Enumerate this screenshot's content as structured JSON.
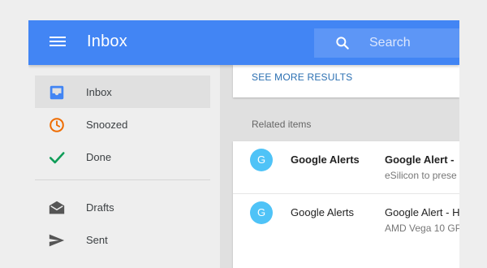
{
  "header": {
    "title": "Inbox",
    "search_placeholder": "Search",
    "accent_color": "#4285f4"
  },
  "sidebar": {
    "items": [
      {
        "label": "Inbox",
        "icon": "inbox-icon",
        "active": true,
        "color": "#4285f4"
      },
      {
        "label": "Snoozed",
        "icon": "clock-icon",
        "active": false,
        "color": "#ef6c00"
      },
      {
        "label": "Done",
        "icon": "check-icon",
        "active": false,
        "color": "#0f9d58"
      },
      {
        "label": "Drafts",
        "icon": "drafts-icon",
        "active": false,
        "color": "#555555"
      },
      {
        "label": "Sent",
        "icon": "send-icon",
        "active": false,
        "color": "#555555"
      }
    ]
  },
  "main": {
    "see_more_label": "SEE MORE RESULTS",
    "related_label": "Related items",
    "emails": [
      {
        "avatar": "G",
        "sender": "Google Alerts",
        "subject": "Google Alert -",
        "snippet": "eSilicon to prese",
        "unread": true
      },
      {
        "avatar": "G",
        "sender": "Google Alerts",
        "subject": "Google Alert - H",
        "snippet": "AMD Vega 10 GP",
        "unread": false
      }
    ]
  }
}
